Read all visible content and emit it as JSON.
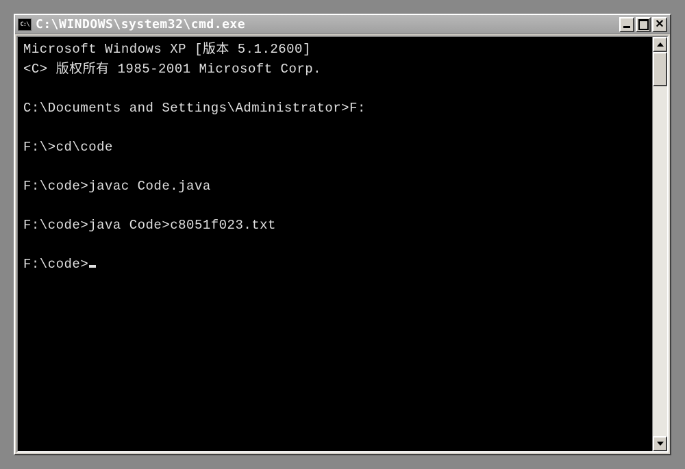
{
  "window": {
    "icon_label": "C:\\",
    "title": "C:\\WINDOWS\\system32\\cmd.exe"
  },
  "console": {
    "lines": [
      "Microsoft Windows XP [版本 5.1.2600]",
      "<C> 版权所有 1985-2001 Microsoft Corp.",
      "",
      "C:\\Documents and Settings\\Administrator>F:",
      "",
      "F:\\>cd\\code",
      "",
      "F:\\code>javac Code.java",
      "",
      "F:\\code>java Code>c8051f023.txt",
      "",
      "F:\\code>"
    ]
  }
}
